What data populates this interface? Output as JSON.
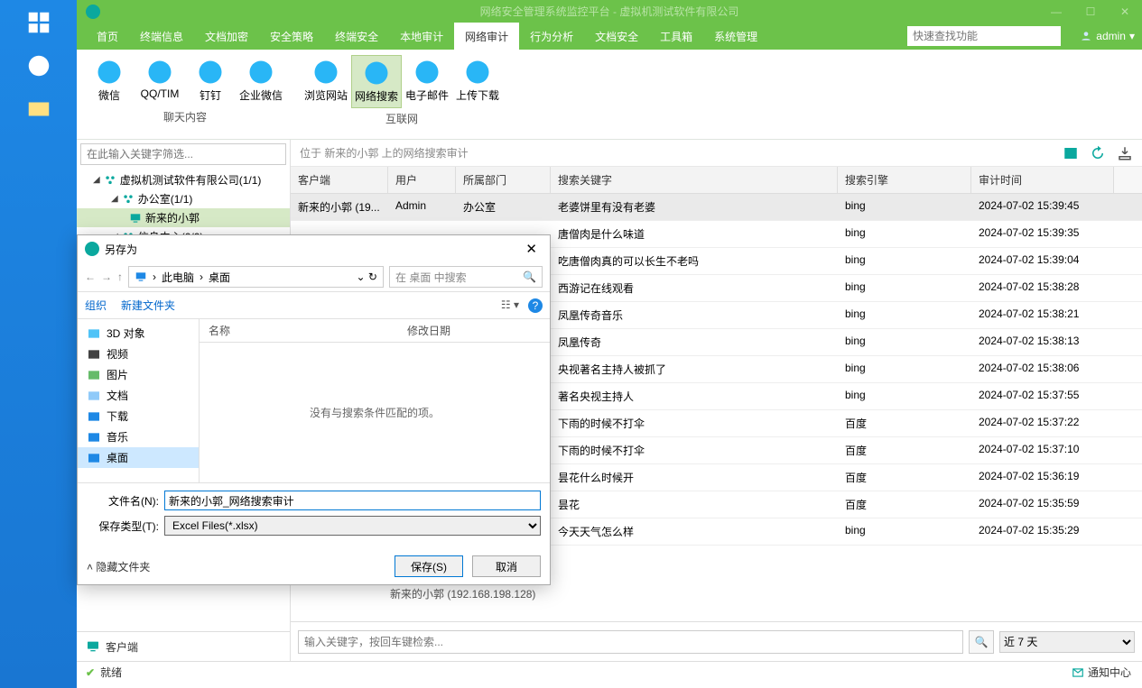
{
  "title": "网络安全管理系统监控平台 - 虚拟机测试软件有限公司",
  "user": "admin",
  "menu": [
    "首页",
    "终端信息",
    "文档加密",
    "安全策略",
    "终端安全",
    "本地审计",
    "网络审计",
    "行为分析",
    "文档安全",
    "工具箱",
    "系统管理"
  ],
  "menu_active": "网络审计",
  "search_placeholder": "快速查找功能",
  "ribbon": {
    "g1": {
      "label": "聊天内容",
      "items": [
        "微信",
        "QQ/TIM",
        "钉钉",
        "企业微信"
      ]
    },
    "g2": {
      "label": "互联网",
      "items": [
        "浏览网站",
        "网络搜索",
        "电子邮件",
        "上传下载"
      ],
      "active": "网络搜索"
    }
  },
  "tree_search": "在此输入关键字筛选...",
  "tree": [
    {
      "label": "虚拟机测试软件有限公司(1/1)",
      "level": 1
    },
    {
      "label": "办公室(1/1)",
      "level": 2
    },
    {
      "label": "新来的小郭",
      "level": 3,
      "selected": true
    },
    {
      "label": "信息中心(0/0)",
      "level": 2
    }
  ],
  "breadcrumb": "位于 新来的小郭 上的网络搜索审计",
  "columns": [
    "客户端",
    "用户",
    "所属部门",
    "搜索关键字",
    "搜索引擎",
    "审计时间"
  ],
  "rows": [
    [
      "新来的小郭 (19...",
      "Admin",
      "办公室",
      "老婆饼里有没有老婆",
      "bing",
      "2024-07-02 15:39:45"
    ],
    [
      "",
      "",
      "",
      "唐僧肉是什么味道",
      "bing",
      "2024-07-02 15:39:35"
    ],
    [
      "",
      "",
      "",
      "吃唐僧肉真的可以长生不老吗",
      "bing",
      "2024-07-02 15:39:04"
    ],
    [
      "",
      "",
      "",
      "西游记在线观看",
      "bing",
      "2024-07-02 15:38:28"
    ],
    [
      "",
      "",
      "",
      "凤凰传奇音乐",
      "bing",
      "2024-07-02 15:38:21"
    ],
    [
      "",
      "",
      "",
      "凤凰传奇",
      "bing",
      "2024-07-02 15:38:13"
    ],
    [
      "",
      "",
      "",
      "央视著名主持人被抓了",
      "bing",
      "2024-07-02 15:38:06"
    ],
    [
      "",
      "",
      "",
      "著名央视主持人",
      "bing",
      "2024-07-02 15:37:55"
    ],
    [
      "",
      "",
      "",
      "下雨的时候不打伞",
      "百度",
      "2024-07-02 15:37:22"
    ],
    [
      "",
      "",
      "",
      "下雨的时候不打伞",
      "百度",
      "2024-07-02 15:37:10"
    ],
    [
      "",
      "",
      "",
      "昙花什么时候开",
      "百度",
      "2024-07-02 15:36:19"
    ],
    [
      "",
      "",
      "",
      "昙花",
      "百度",
      "2024-07-02 15:35:59"
    ],
    [
      "",
      "",
      "",
      "今天天气怎么样",
      "bing",
      "2024-07-02 15:35:29"
    ]
  ],
  "hostinfo": "新来的小郭 (192.168.198.128)",
  "kw_placeholder": "输入关键字，按回车键检索...",
  "range": "近 7 天",
  "client_tab": "客户端",
  "status": "就绪",
  "notice": "通知中心",
  "dialog": {
    "title": "另存为",
    "path": [
      "此电脑",
      "桌面"
    ],
    "search_ph": "在 桌面 中搜索",
    "org": "组织",
    "newfolder": "新建文件夹",
    "side": [
      "3D 对象",
      "视频",
      "图片",
      "文档",
      "下载",
      "音乐",
      "桌面"
    ],
    "side_sel": "桌面",
    "hdr_name": "名称",
    "hdr_date": "修改日期",
    "empty": "没有与搜索条件匹配的项。",
    "fn_label": "文件名(N):",
    "fn_value": "新来的小郭_网络搜索审计",
    "ft_label": "保存类型(T):",
    "ft_value": "Excel Files(*.xlsx)",
    "hide": "隐藏文件夹",
    "save": "保存(S)",
    "cancel": "取消"
  }
}
